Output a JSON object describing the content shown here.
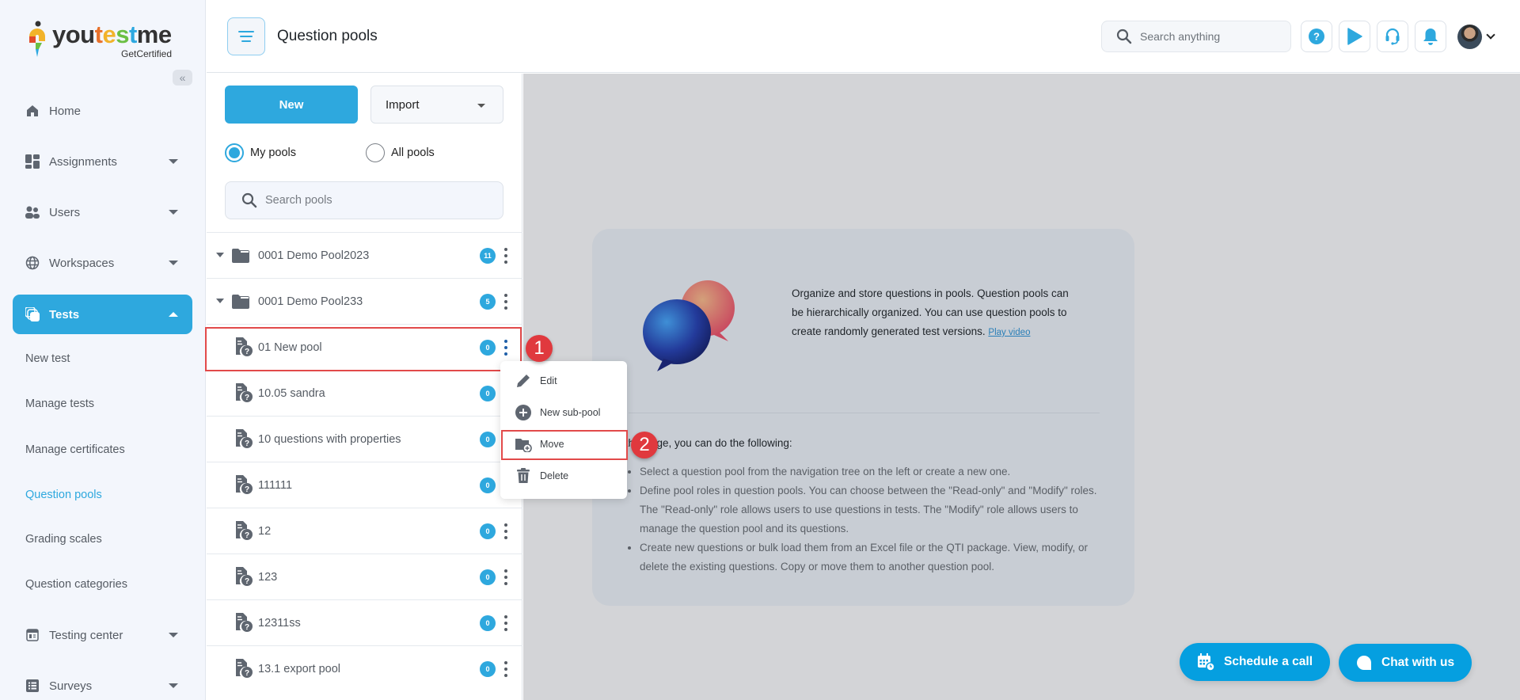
{
  "brand": {
    "name_parts": [
      "you",
      "t",
      "e",
      "s",
      "t",
      "me"
    ],
    "logo_text": "youtestme",
    "tagline": "GetCertified",
    "accent_color": "#2ea8de"
  },
  "sidebar": {
    "collapse_label": "«",
    "items": [
      {
        "label": "Home",
        "icon": "home-icon"
      },
      {
        "label": "Assignments",
        "icon": "dashboard-icon",
        "has_caret": true
      },
      {
        "label": "Users",
        "icon": "users-icon",
        "has_caret": true
      },
      {
        "label": "Workspaces",
        "icon": "globe-icon",
        "has_caret": true
      },
      {
        "label": "Tests",
        "icon": "copy-icon",
        "has_caret": true,
        "active": true
      },
      {
        "label": "Testing center",
        "icon": "calendar-icon",
        "has_caret": true
      },
      {
        "label": "Surveys",
        "icon": "list-icon",
        "has_caret": true
      }
    ],
    "sub_items": [
      {
        "label": "New test"
      },
      {
        "label": "Manage tests"
      },
      {
        "label": "Manage certificates"
      },
      {
        "label": "Question pools",
        "current": true
      },
      {
        "label": "Grading scales"
      },
      {
        "label": "Question categories"
      }
    ]
  },
  "header": {
    "title": "Question pools",
    "search_placeholder": "Search anything"
  },
  "pools": {
    "new_label": "New",
    "import_label": "Import",
    "filter": {
      "options": [
        "My pools",
        "All pools"
      ],
      "selected": "My pools"
    },
    "search_placeholder": "Search pools",
    "rows": [
      {
        "label": "0001 Demo Pool2023",
        "count": "11",
        "type": "folder",
        "expanded": true
      },
      {
        "label": "0001 Demo Pool233",
        "count": "5",
        "type": "folder",
        "expanded": true
      },
      {
        "label": "01 New pool",
        "count": "0",
        "type": "pool",
        "highlighted": true
      },
      {
        "label": "10.05 sandra",
        "count": "0",
        "type": "pool"
      },
      {
        "label": "10 questions with properties",
        "count": "0",
        "type": "pool"
      },
      {
        "label": "111111",
        "count": "0",
        "type": "pool"
      },
      {
        "label": "12",
        "count": "0",
        "type": "pool"
      },
      {
        "label": "123",
        "count": "0",
        "type": "pool"
      },
      {
        "label": "12311ss",
        "count": "0",
        "type": "pool"
      },
      {
        "label": "13.1 export pool",
        "count": "0",
        "type": "pool"
      }
    ]
  },
  "context_menu": {
    "items": [
      {
        "label": "Edit",
        "icon": "pencil-icon"
      },
      {
        "label": "New sub-pool",
        "icon": "plus-circle-icon"
      },
      {
        "label": "Move",
        "icon": "folder-move-icon",
        "highlighted": true
      },
      {
        "label": "Delete",
        "icon": "trash-icon"
      }
    ]
  },
  "steps": [
    "1",
    "2"
  ],
  "info_card": {
    "intro": "Organize and store questions in pools. Question pools can be hierarchically organized. You can use question pools to create randomly generated test versions.",
    "play_video": "Play video",
    "heading": "On this page, you can do the following:",
    "bullets": [
      "Select a question pool from the navigation tree on the left or create a new one.",
      "Define pool roles in question pools. You can choose between the \"Read-only\" and \"Modify\" roles. The \"Read-only\" role allows users to use questions in tests. The \"Modify\" role allows users to manage the question pool and its questions.",
      "Create new questions or bulk load them from an Excel file or the QTI package. View, modify, or delete the existing questions. Copy or move them to another question pool."
    ]
  },
  "floating": {
    "schedule_label": "Schedule a call",
    "chat_label": "Chat with us"
  }
}
